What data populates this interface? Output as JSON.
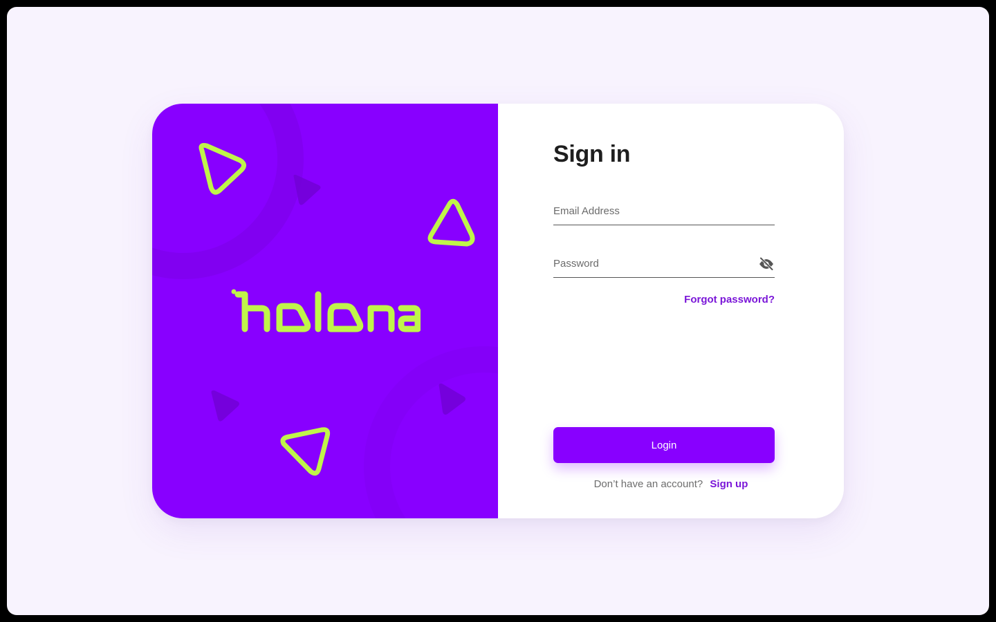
{
  "brand": {
    "logo_text": "holona",
    "panel_color": "#8800ff",
    "accent_color": "#c0f54a"
  },
  "form": {
    "title": "Sign in",
    "email": {
      "value": "",
      "placeholder": "Email Address"
    },
    "password": {
      "value": "",
      "placeholder": "Password",
      "toggle_icon": "eye-off-icon"
    },
    "forgot_label": "Forgot password?",
    "login_label": "Login",
    "signup_prompt": "Don’t have an account?",
    "signup_label": "Sign up"
  },
  "colors": {
    "page_background": "#f8f3fe",
    "primary": "#8800ff",
    "link": "#7a16d8"
  }
}
